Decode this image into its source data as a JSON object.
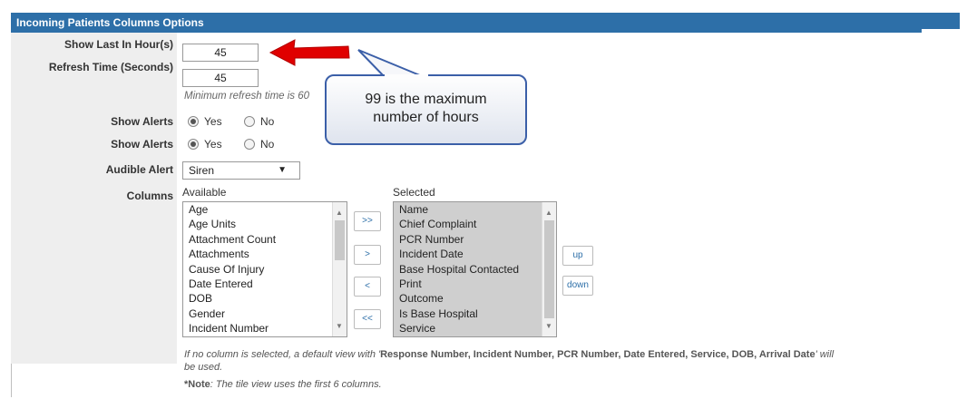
{
  "header": {
    "title": "Incoming Patients Columns Options"
  },
  "fields": {
    "show_last_label": "Show Last In Hour(s)",
    "show_last_value": "45",
    "refresh_label": "Refresh Time (Seconds)",
    "refresh_value": "45",
    "refresh_hint": "Minimum refresh time is 60",
    "show_alerts_label_1": "Show Alerts",
    "show_alerts_label_2": "Show Alerts",
    "yes": "Yes",
    "no": "No",
    "audible_label": "Audible Alert",
    "audible_value": "Siren",
    "columns_label": "Columns"
  },
  "columns": {
    "available_label": "Available",
    "selected_label": "Selected",
    "available": [
      "Age",
      "Age Units",
      "Attachment Count",
      "Attachments",
      "Cause Of Injury",
      "Date Entered",
      "DOB",
      "Gender",
      "Incident Number"
    ],
    "selected": [
      "Name",
      "Chief Complaint",
      "PCR Number",
      "Incident Date",
      "Base Hospital Contacted",
      "Print",
      "Outcome",
      "Is Base Hospital",
      "Service"
    ],
    "buttons": {
      "add_all": ">>",
      "add": ">",
      "remove": "<",
      "remove_all": "<<",
      "up": "up",
      "down": "down"
    }
  },
  "callout": {
    "line1": "99 is the maximum",
    "line2": "number of hours"
  },
  "notes": {
    "default_prefix": "If no column is selected, a default view with '",
    "default_bold": "Response Number, Incident Number, PCR Number, Date Entered, Service, DOB, Arrival Date",
    "default_suffix": "' will",
    "default_line2": "be used.",
    "tile_prefix": "*Note",
    "tile_text": ": The tile view uses the first 6 columns."
  },
  "colors": {
    "header_bg": "#2d6fa8",
    "arrow": "#e00000",
    "callout_border": "#3b5fa8"
  }
}
